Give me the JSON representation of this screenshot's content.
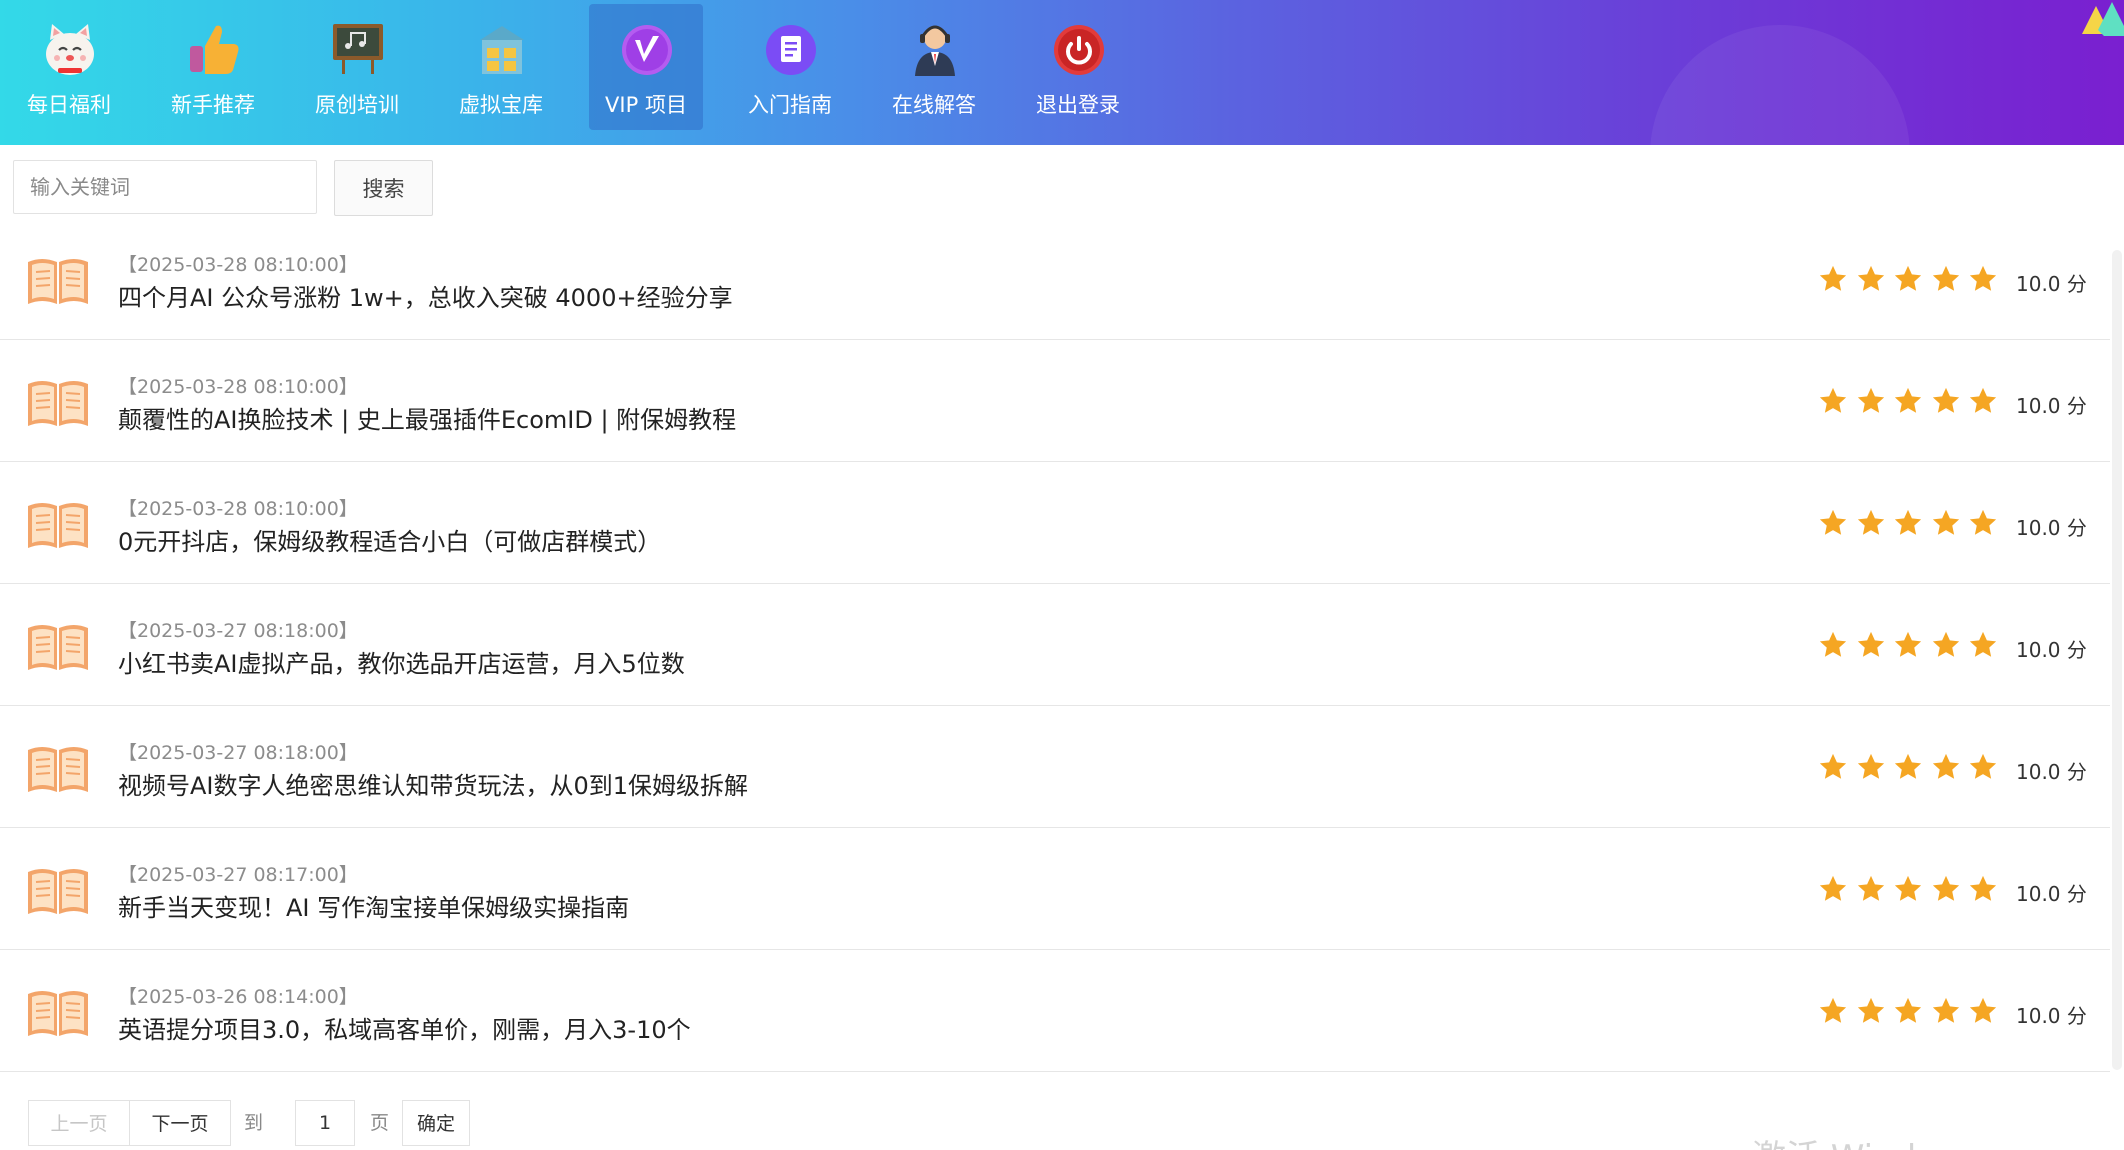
{
  "nav": {
    "items": [
      {
        "label": "每日福利",
        "icon": "lucky-cat-icon"
      },
      {
        "label": "新手推荐",
        "icon": "thumbs-up-icon"
      },
      {
        "label": "原创培训",
        "icon": "chalkboard-icon"
      },
      {
        "label": "虚拟宝库",
        "icon": "treasure-vault-icon"
      },
      {
        "label": "VIP 项目",
        "icon": "vip-badge-icon",
        "active": true
      },
      {
        "label": "入门指南",
        "icon": "guide-document-icon"
      },
      {
        "label": "在线解答",
        "icon": "support-agent-icon"
      },
      {
        "label": "退出登录",
        "icon": "power-icon"
      }
    ]
  },
  "search": {
    "placeholder": "输入关键词",
    "button_label": "搜索"
  },
  "list": {
    "rating_stars": 5,
    "items": [
      {
        "date": "【2025-03-28 08:10:00】",
        "title": "四个月AI 公众号涨粉 1w+，总收入突破 4000+经验分享",
        "score": "10.0 分"
      },
      {
        "date": "【2025-03-28 08:10:00】",
        "title": "颠覆性的AI换脸技术 | 史上最强插件EcomID | 附保姆教程",
        "score": "10.0 分"
      },
      {
        "date": "【2025-03-28 08:10:00】",
        "title": "0元开抖店，保姆级教程适合小白（可做店群模式）",
        "score": "10.0 分"
      },
      {
        "date": "【2025-03-27 08:18:00】",
        "title": "小红书卖AI虚拟产品，教你选品开店运营，月入5位数",
        "score": "10.0 分"
      },
      {
        "date": "【2025-03-27 08:18:00】",
        "title": "视频号AI数字人绝密思维认知带货玩法，从0到1保姆级拆解",
        "score": "10.0 分"
      },
      {
        "date": "【2025-03-27 08:17:00】",
        "title": "新手当天变现！AI 写作淘宝接单保姆级实操指南",
        "score": "10.0 分"
      },
      {
        "date": "【2025-03-26 08:14:00】",
        "title": "英语提分项目3.0，私域高客单价，刚需，月入3-10个",
        "score": "10.0 分"
      }
    ]
  },
  "pagination": {
    "prev_label": "上一页",
    "next_label": "下一页",
    "goto_prefix": "到第",
    "page_value": "1",
    "page_suffix": "页",
    "confirm_label": "确定"
  },
  "watermark": "激活 Windows",
  "colors": {
    "star": "#f5a623",
    "book": "#f3a56a",
    "header_start": "#33d9e8",
    "header_end": "#7a1fd0"
  }
}
